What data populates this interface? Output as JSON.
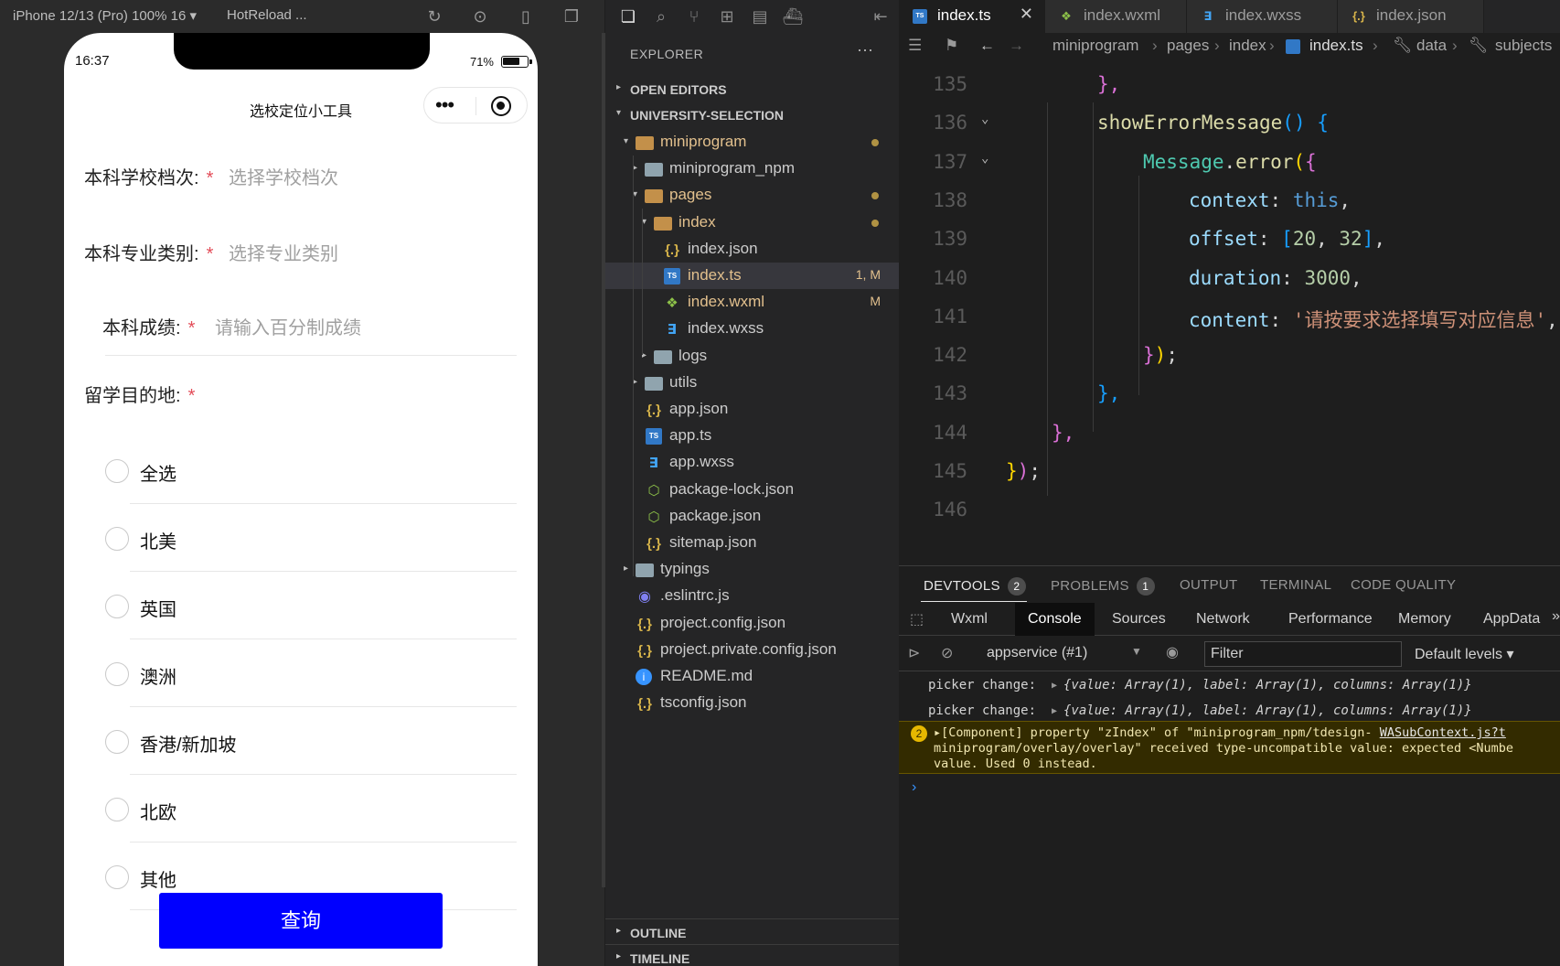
{
  "simulator": {
    "device": "iPhone 12/13 (Pro) 100% 16 ▾",
    "hotreload": "HotReload ...",
    "time": "16:37",
    "battery_pct": "71%",
    "battery_level": 0.71,
    "nav_title": "选校定位小工具",
    "fields": [
      {
        "label": "本科学校档次:",
        "required": "*",
        "placeholder": "选择学校档次"
      },
      {
        "label": "本科专业类别:",
        "required": "*",
        "placeholder": "选择专业类别"
      },
      {
        "label": "本科成绩:",
        "required": "*",
        "placeholder": "请输入百分制成绩"
      }
    ],
    "destination": {
      "label": "留学目的地:",
      "required": "*"
    },
    "options": [
      "全选",
      "北美",
      "英国",
      "澳洲",
      "香港/新加坡",
      "北欧",
      "其他"
    ],
    "submit": "查询"
  },
  "explorer": {
    "title": "EXPLORER",
    "more": "···",
    "sections": {
      "open_editors": "OPEN EDITORS",
      "project": "UNIVERSITY-SELECTION",
      "outline": "OUTLINE",
      "timeline": "TIMELINE"
    },
    "tree": [
      {
        "name": "miniprogram",
        "depth": 1,
        "icon": "folder-open-icon",
        "chev": "▾",
        "dot": true,
        "color": "#e2c08d"
      },
      {
        "name": "miniprogram_npm",
        "depth": 2,
        "icon": "folder-icon",
        "chev": "▸"
      },
      {
        "name": "pages",
        "depth": 2,
        "icon": "folder-open-icon",
        "chev": "▾",
        "dot": true,
        "color": "#e2c08d"
      },
      {
        "name": "index",
        "depth": 3,
        "icon": "folder-open-icon",
        "chev": "▾",
        "dot": true,
        "color": "#e2c08d"
      },
      {
        "name": "index.json",
        "depth": 4,
        "icon": "json-icon"
      },
      {
        "name": "index.ts",
        "depth": 4,
        "icon": "ts-icon",
        "badge": "1, M",
        "selected": true,
        "color": "#e2c08d"
      },
      {
        "name": "index.wxml",
        "depth": 4,
        "icon": "wxml-icon",
        "badge": "M",
        "color": "#e2c08d"
      },
      {
        "name": "index.wxss",
        "depth": 4,
        "icon": "wxss-icon"
      },
      {
        "name": "logs",
        "depth": 3,
        "icon": "folder-icon",
        "chev": "▸"
      },
      {
        "name": "utils",
        "depth": 2,
        "icon": "folder-icon",
        "chev": "▸"
      },
      {
        "name": "app.json",
        "depth": 2,
        "icon": "json-icon"
      },
      {
        "name": "app.ts",
        "depth": 2,
        "icon": "ts-icon"
      },
      {
        "name": "app.wxss",
        "depth": 2,
        "icon": "wxss-icon"
      },
      {
        "name": "package-lock.json",
        "depth": 2,
        "icon": "package-icon"
      },
      {
        "name": "package.json",
        "depth": 2,
        "icon": "package-icon"
      },
      {
        "name": "sitemap.json",
        "depth": 2,
        "icon": "json-icon"
      },
      {
        "name": "typings",
        "depth": 1,
        "icon": "folder-icon",
        "chev": "▸"
      },
      {
        "name": ".eslintrc.js",
        "depth": 1,
        "icon": "eslint-icon"
      },
      {
        "name": "project.config.json",
        "depth": 1,
        "icon": "json-icon"
      },
      {
        "name": "project.private.config.json",
        "depth": 1,
        "icon": "json-icon"
      },
      {
        "name": "README.md",
        "depth": 1,
        "icon": "info-icon"
      },
      {
        "name": "tsconfig.json",
        "depth": 1,
        "icon": "json-icon"
      }
    ]
  },
  "editor": {
    "tabs": [
      {
        "label": "index.ts",
        "icon": "ts-icon",
        "active": true,
        "close": "✕"
      },
      {
        "label": "index.wxml",
        "icon": "wxml-icon"
      },
      {
        "label": "index.wxss",
        "icon": "wxss-icon"
      },
      {
        "label": "index.json",
        "icon": "json-icon"
      }
    ],
    "breadcrumb": [
      "miniprogram",
      "pages",
      "index",
      "index.ts",
      "data",
      "subjects"
    ],
    "lines": [
      {
        "n": "135",
        "fold": "",
        "indent": 2,
        "tokens": [
          [
            "k-br2",
            "},"
          ]
        ]
      },
      {
        "n": "136",
        "fold": "⌄",
        "indent": 2,
        "tokens": [
          [
            "k-fn",
            "showErrorMessage"
          ],
          [
            "k-br3",
            "()"
          ],
          [
            "k-plain",
            " "
          ],
          [
            "k-br3",
            "{"
          ]
        ]
      },
      {
        "n": "137",
        "fold": "⌄",
        "indent": 3,
        "tokens": [
          [
            "k-obj",
            "Message"
          ],
          [
            "k-plain",
            "."
          ],
          [
            "k-fn",
            "error"
          ],
          [
            "k-br1",
            "("
          ],
          [
            "k-br2",
            "{"
          ]
        ]
      },
      {
        "n": "138",
        "fold": "",
        "indent": 4,
        "tokens": [
          [
            "k-prop",
            "context"
          ],
          [
            "k-plain",
            ": "
          ],
          [
            "k-kw",
            "this"
          ],
          [
            "k-plain",
            ","
          ]
        ]
      },
      {
        "n": "139",
        "fold": "",
        "indent": 4,
        "tokens": [
          [
            "k-prop",
            "offset"
          ],
          [
            "k-plain",
            ": "
          ],
          [
            "k-br3",
            "["
          ],
          [
            "k-num",
            "20"
          ],
          [
            "k-plain",
            ", "
          ],
          [
            "k-num",
            "32"
          ],
          [
            "k-br3",
            "]"
          ],
          [
            "k-plain",
            ","
          ]
        ]
      },
      {
        "n": "140",
        "fold": "",
        "indent": 4,
        "tokens": [
          [
            "k-prop",
            "duration"
          ],
          [
            "k-plain",
            ": "
          ],
          [
            "k-num",
            "3000"
          ],
          [
            "k-plain",
            ","
          ]
        ]
      },
      {
        "n": "141",
        "fold": "",
        "indent": 4,
        "tokens": [
          [
            "k-prop",
            "content"
          ],
          [
            "k-plain",
            ": "
          ],
          [
            "k-str",
            "'请按要求选择填写对应信息'"
          ],
          [
            "k-plain",
            ","
          ]
        ]
      },
      {
        "n": "142",
        "fold": "",
        "indent": 3,
        "tokens": [
          [
            "k-br2",
            "}"
          ],
          [
            "k-br1",
            ")"
          ],
          [
            "k-plain",
            ";"
          ]
        ]
      },
      {
        "n": "143",
        "fold": "",
        "indent": 2,
        "tokens": [
          [
            "k-br3",
            "},"
          ]
        ]
      },
      {
        "n": "144",
        "fold": "",
        "indent": 1,
        "tokens": [
          [
            "k-br2",
            "},"
          ]
        ]
      },
      {
        "n": "145",
        "fold": "",
        "indent": 0,
        "tokens": [
          [
            "k-br1",
            "}"
          ],
          [
            "k-br2",
            ")"
          ],
          [
            "k-plain",
            ";"
          ]
        ]
      },
      {
        "n": "146",
        "fold": "",
        "indent": 0,
        "tokens": []
      }
    ]
  },
  "panel": {
    "tabs": [
      {
        "label": "DEVTOOLS",
        "badge": "2",
        "active": true
      },
      {
        "label": "PROBLEMS",
        "badge": "1"
      },
      {
        "label": "OUTPUT"
      },
      {
        "label": "TERMINAL"
      },
      {
        "label": "CODE QUALITY"
      }
    ],
    "devtools_tabs": [
      "Wxml",
      "Console",
      "Sources",
      "Network",
      "Performance",
      "Memory",
      "AppData"
    ],
    "devtools_more": "»",
    "context": "appservice (#1)",
    "filter_placeholder": "Filter",
    "levels": "Default levels ▾",
    "logs": [
      {
        "prefix": "picker change: ",
        "obj": "{value: Array(1), label: Array(1), columns: Array(1)}"
      },
      {
        "prefix": "picker change: ",
        "obj": "{value: Array(1), label: Array(1), columns: Array(1)}"
      }
    ],
    "warning": {
      "count": "2",
      "line1": "[Component] property \"zIndex\" of \"miniprogram_npm/tdesign-",
      "link": "WASubContext.js?t",
      "line2": "miniprogram/overlay/overlay\" received type-uncompatible value: expected <Numbe",
      "line3": "value. Used 0 instead."
    },
    "prompt": "›"
  }
}
